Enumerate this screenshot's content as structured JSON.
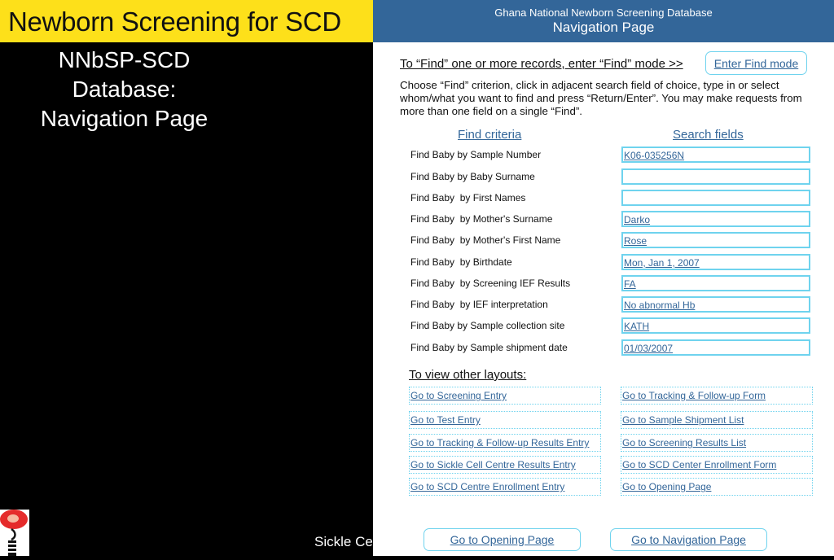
{
  "slide": {
    "title": "Newborn Screening for SCD",
    "subtitle_lines": [
      "NNbSP-SCD",
      "Database:",
      "Navigation Page"
    ],
    "footer_text": "Sickle Ce",
    "logo_icon": "sickle-cell-logo-icon"
  },
  "app": {
    "header_line1": "Ghana National Newborn Screening Database",
    "header_line2": "Navigation Page",
    "find_intro": "To “Find” one or more records, enter “Find” mode >>",
    "enter_find_label": "Enter Find mode",
    "instructions": "Choose “Find” criterion, click in adjacent search field of choice, type in or select whom/what you want to find and press “Return/Enter”. You may make requests from more than one field on a single “Find”.",
    "criteria_header": "Find criteria",
    "fields_header": "Search fields",
    "criteria": [
      {
        "label": "Find Baby by Sample Number",
        "value": "K06-035256N"
      },
      {
        "label": "Find Baby by Baby Surname",
        "value": ""
      },
      {
        "label": "Find Baby  by First Names",
        "value": ""
      },
      {
        "label": "Find Baby  by Mother's Surname",
        "value": "Darko"
      },
      {
        "label": "Find Baby  by Mother's First Name",
        "value": "Rose"
      },
      {
        "label": "Find Baby  by Birthdate",
        "value": "Mon, Jan 1, 2007"
      },
      {
        "label": "Find Baby  by Screening IEF Results",
        "value": "FA"
      },
      {
        "label": "Find Baby  by IEF interpretation",
        "value": "No abnormal Hb"
      },
      {
        "label": "Find Baby by Sample collection site",
        "value": "KATH"
      },
      {
        "label": "Find Baby by Sample shipment date",
        "value": "01/03/2007"
      }
    ],
    "layouts_header": "To view other layouts:",
    "layouts_left": [
      "Go to Screening Entry",
      "Go to Test Entry",
      "Go to Tracking & Follow-up Results Entry",
      "Go to Sickle Cell Centre Results Entry",
      "Go to SCD Centre Enrollment Entry"
    ],
    "layouts_right": [
      "Go to Tracking & Follow-up Form",
      "Go to Sample Shipment List",
      "Go to Screening Results List",
      "Go to SCD Center Enrollment Form",
      "Go to Opening Page"
    ],
    "bottom_buttons": [
      "Go to Opening Page",
      "Go to Navigation Page"
    ]
  }
}
